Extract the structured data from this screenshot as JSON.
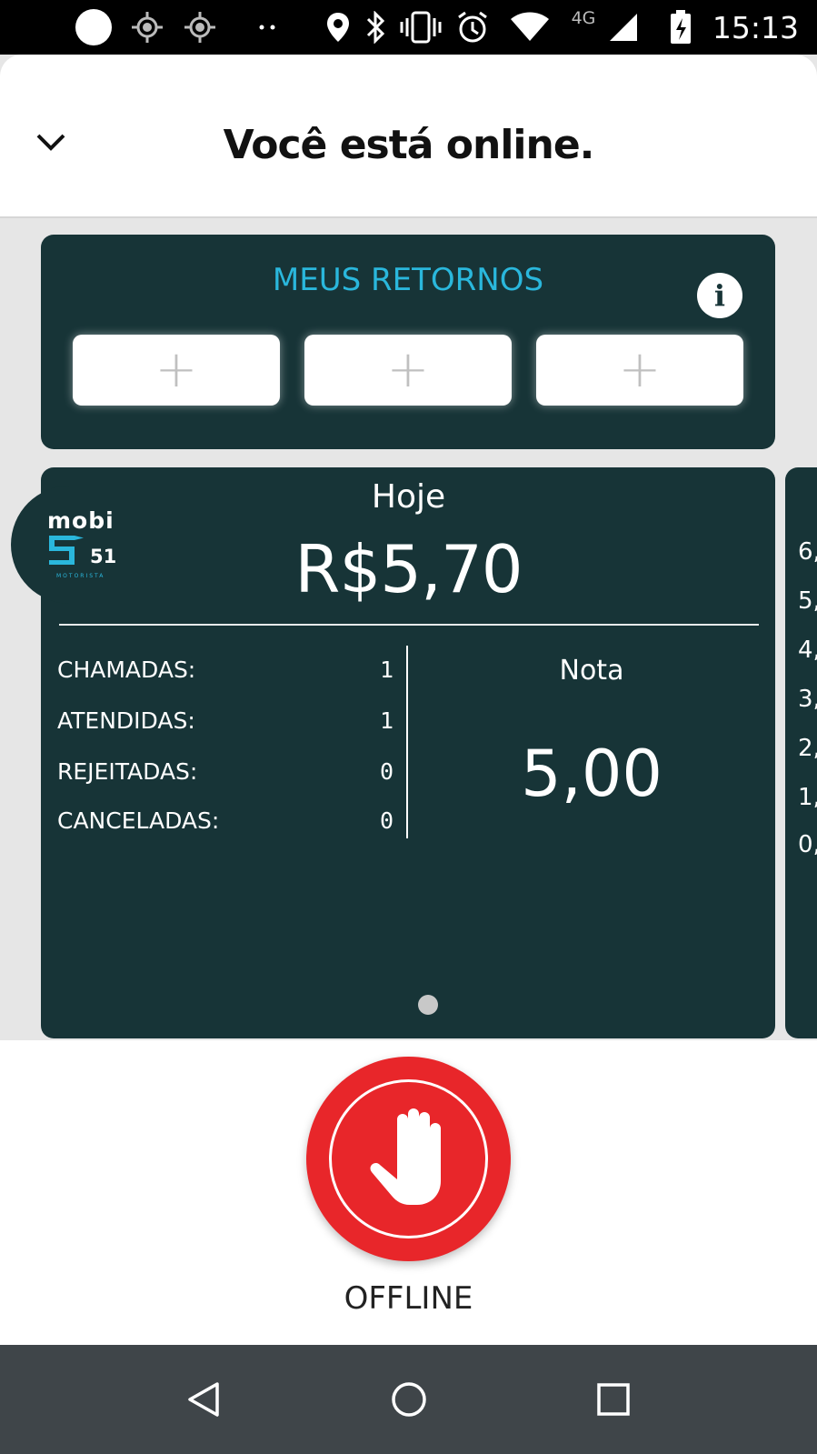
{
  "status_bar": {
    "time": "15:13",
    "network_label": "4G",
    "icons": [
      "circle-icon",
      "location-target-icon",
      "location-target-icon",
      "more-dots-icon",
      "location-pin-icon",
      "bluetooth-icon",
      "vibrate-icon",
      "alarm-icon",
      "wifi-icon",
      "cell-signal-icon",
      "battery-charging-icon"
    ]
  },
  "header": {
    "title": "Você está online.",
    "collapse_icon": "chevron-down-icon"
  },
  "returns": {
    "title": "MEUS RETORNOS",
    "info_glyph": "i",
    "slots": [
      {
        "label": "+"
      },
      {
        "label": "+"
      },
      {
        "label": "+"
      }
    ]
  },
  "stats": {
    "logo": {
      "word": "mobi",
      "number": "51",
      "sub": "MOTORISTA"
    },
    "period": "Hoje",
    "earnings": "R$5,70",
    "rows": [
      {
        "label": "CHAMADAS:",
        "value": "1"
      },
      {
        "label": "ATENDIDAS:",
        "value": "1"
      },
      {
        "label": "REJEITADAS:",
        "value": "0"
      },
      {
        "label": "CANCELADAS:",
        "value": "0"
      }
    ],
    "rating_label": "Nota",
    "rating_value": "5,00"
  },
  "peek_card": {
    "ticks": [
      "6,",
      "5,",
      "4,",
      "3,",
      "2,",
      "1,",
      "0,"
    ]
  },
  "action": {
    "button_label": "OFFLINE",
    "button_color": "#e8262a",
    "icon": "stop-hand-icon"
  },
  "colors": {
    "card_bg": "#173437",
    "accent": "#2ab7dc",
    "stop_red": "#e8262a"
  },
  "nav_bar": {
    "buttons": [
      "back-triangle-icon",
      "home-circle-icon",
      "recents-square-icon"
    ]
  }
}
